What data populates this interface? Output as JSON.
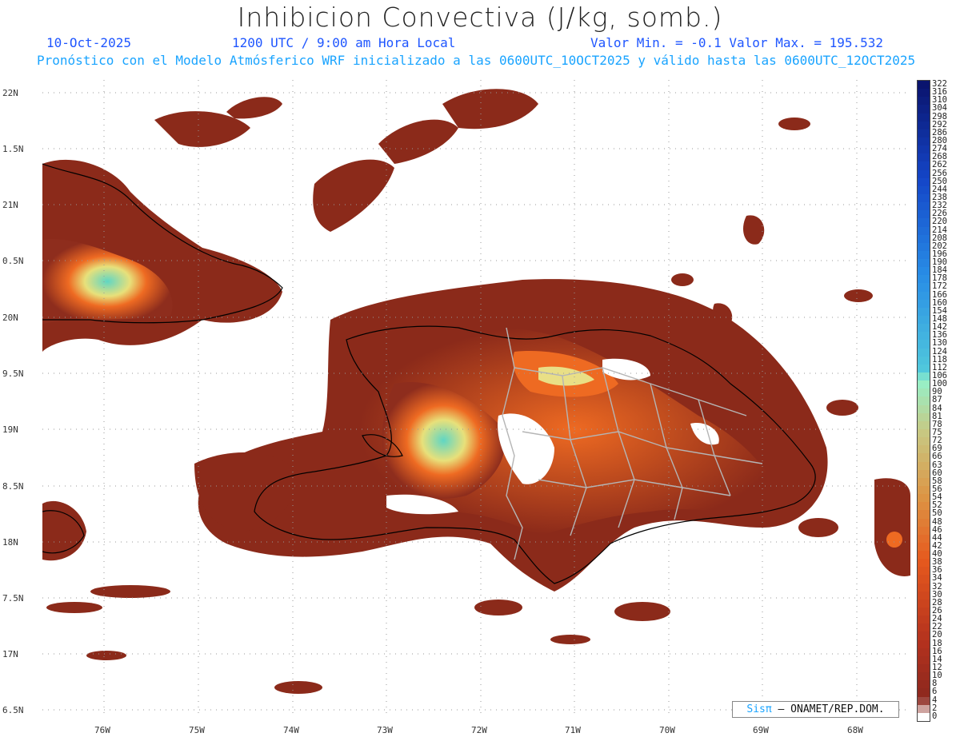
{
  "header": {
    "title": "Inhibicion Convectiva (J/kg, somb.)",
    "date": "10-Oct-2025",
    "time": "1200 UTC / 9:00 am Hora Local",
    "minmax": "Valor Min. = -0.1  Valor Max. = 195.532",
    "forecast": "Pronóstico con el Modelo Atmósferico WRF inicializado a las 0600UTC_10OCT2025 y válido hasta las  0600UTC_12OCT2025"
  },
  "axes": {
    "y_labels": [
      "22N",
      "1.5N",
      "21N",
      "0.5N",
      "20N",
      "9.5N",
      "19N",
      "8.5N",
      "18N",
      "7.5N",
      "17N",
      "6.5N"
    ],
    "x_labels": [
      "76W",
      "75W",
      "74W",
      "73W",
      "72W",
      "71W",
      "70W",
      "69W",
      "68W"
    ]
  },
  "colorbar": {
    "labels": [
      "322",
      "316",
      "310",
      "304",
      "298",
      "292",
      "286",
      "280",
      "274",
      "268",
      "262",
      "256",
      "250",
      "244",
      "238",
      "232",
      "226",
      "220",
      "214",
      "208",
      "202",
      "196",
      "190",
      "184",
      "178",
      "172",
      "166",
      "160",
      "154",
      "148",
      "142",
      "136",
      "130",
      "124",
      "118",
      "112",
      "106",
      "100",
      "90",
      "87",
      "84",
      "81",
      "78",
      "75",
      "72",
      "69",
      "66",
      "63",
      "60",
      "58",
      "56",
      "54",
      "52",
      "50",
      "48",
      "46",
      "44",
      "42",
      "40",
      "38",
      "36",
      "34",
      "32",
      "30",
      "28",
      "26",
      "24",
      "22",
      "20",
      "18",
      "16",
      "14",
      "12",
      "10",
      "8",
      "6",
      "4",
      "2",
      "0"
    ]
  },
  "credit": {
    "logo": "Sisπ",
    "text": "– ONAMET/REP.DOM."
  },
  "colors": {
    "land_low": "#8b2a1a",
    "mid": "#e8581a",
    "high": "#6fdcc8",
    "accent_blue": "#1f56ff",
    "accent_cyan": "#1aa4ff"
  }
}
